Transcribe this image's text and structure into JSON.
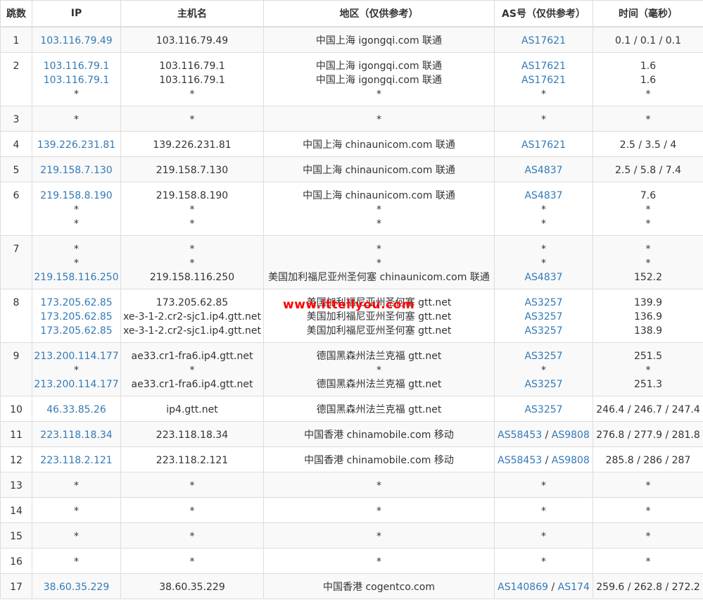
{
  "headers": [
    "跳数",
    "IP",
    "主机名",
    "地区（仅供参考）",
    "AS号（仅供参考）",
    "时间（毫秒）"
  ],
  "watermark": "www.ittellyou.com",
  "rows": [
    {
      "hop": "1",
      "lines": [
        {
          "ip": "103.116.79.49",
          "host": "103.116.79.49",
          "loc": "中国上海 igongqi.com 联通",
          "as": [
            "AS17621"
          ],
          "time": "0.1 / 0.1 / 0.1"
        }
      ]
    },
    {
      "hop": "2",
      "lines": [
        {
          "ip": "103.116.79.1",
          "host": "103.116.79.1",
          "loc": "中国上海 igongqi.com 联通",
          "as": [
            "AS17621"
          ],
          "time": "1.6"
        },
        {
          "ip": "103.116.79.1",
          "host": "103.116.79.1",
          "loc": "中国上海 igongqi.com 联通",
          "as": [
            "AS17621"
          ],
          "time": "1.6"
        },
        {
          "ip": "*",
          "host": "*",
          "loc": "*",
          "as": [
            "*"
          ],
          "time": "*"
        }
      ]
    },
    {
      "hop": "3",
      "lines": [
        {
          "ip": "*",
          "host": "*",
          "loc": "*",
          "as": [
            "*"
          ],
          "time": "*"
        }
      ]
    },
    {
      "hop": "4",
      "lines": [
        {
          "ip": "139.226.231.81",
          "host": "139.226.231.81",
          "loc": "中国上海 chinaunicom.com 联通",
          "as": [
            "AS17621"
          ],
          "time": "2.5 / 3.5 / 4"
        }
      ]
    },
    {
      "hop": "5",
      "lines": [
        {
          "ip": "219.158.7.130",
          "host": "219.158.7.130",
          "loc": "中国上海 chinaunicom.com 联通",
          "as": [
            "AS4837"
          ],
          "time": "2.5 / 5.8 / 7.4"
        }
      ]
    },
    {
      "hop": "6",
      "lines": [
        {
          "ip": "219.158.8.190",
          "host": "219.158.8.190",
          "loc": "中国上海 chinaunicom.com 联通",
          "as": [
            "AS4837"
          ],
          "time": "7.6"
        },
        {
          "ip": "*",
          "host": "*",
          "loc": "*",
          "as": [
            "*"
          ],
          "time": "*"
        },
        {
          "ip": "*",
          "host": "*",
          "loc": "*",
          "as": [
            "*"
          ],
          "time": "*"
        }
      ]
    },
    {
      "hop": "7",
      "lines": [
        {
          "ip": "*",
          "host": "*",
          "loc": "*",
          "as": [
            "*"
          ],
          "time": "*"
        },
        {
          "ip": "*",
          "host": "*",
          "loc": "*",
          "as": [
            "*"
          ],
          "time": "*"
        },
        {
          "ip": "219.158.116.250",
          "host": "219.158.116.250",
          "loc": "美国加利福尼亚州圣何塞 chinaunicom.com 联通",
          "as": [
            "AS4837"
          ],
          "time": "152.2"
        }
      ]
    },
    {
      "hop": "8",
      "lines": [
        {
          "ip": "173.205.62.85",
          "host": "173.205.62.85",
          "loc": "美国加利福尼亚州圣何塞 gtt.net",
          "as": [
            "AS3257"
          ],
          "time": "139.9"
        },
        {
          "ip": "173.205.62.85",
          "host": "xe-3-1-2.cr2-sjc1.ip4.gtt.net",
          "loc": "美国加利福尼亚州圣何塞 gtt.net",
          "as": [
            "AS3257"
          ],
          "time": "136.9"
        },
        {
          "ip": "173.205.62.85",
          "host": "xe-3-1-2.cr2-sjc1.ip4.gtt.net",
          "loc": "美国加利福尼亚州圣何塞 gtt.net",
          "as": [
            "AS3257"
          ],
          "time": "138.9"
        }
      ]
    },
    {
      "hop": "9",
      "lines": [
        {
          "ip": "213.200.114.177",
          "host": "ae33.cr1-fra6.ip4.gtt.net",
          "loc": "德国黑森州法兰克福 gtt.net",
          "as": [
            "AS3257"
          ],
          "time": "251.5"
        },
        {
          "ip": "*",
          "host": "*",
          "loc": "*",
          "as": [
            "*"
          ],
          "time": "*"
        },
        {
          "ip": "213.200.114.177",
          "host": "ae33.cr1-fra6.ip4.gtt.net",
          "loc": "德国黑森州法兰克福 gtt.net",
          "as": [
            "AS3257"
          ],
          "time": "251.3"
        }
      ]
    },
    {
      "hop": "10",
      "lines": [
        {
          "ip": "46.33.85.26",
          "host": "ip4.gtt.net",
          "loc": "德国黑森州法兰克福 gtt.net",
          "as": [
            "AS3257"
          ],
          "time": "246.4 / 246.7 / 247.4"
        }
      ]
    },
    {
      "hop": "11",
      "lines": [
        {
          "ip": "223.118.18.34",
          "host": "223.118.18.34",
          "loc": "中国香港 chinamobile.com 移动",
          "as": [
            "AS58453",
            "AS9808"
          ],
          "time": "276.8 / 277.9 / 281.8"
        }
      ]
    },
    {
      "hop": "12",
      "lines": [
        {
          "ip": "223.118.2.121",
          "host": "223.118.2.121",
          "loc": "中国香港 chinamobile.com 移动",
          "as": [
            "AS58453",
            "AS9808"
          ],
          "time": "285.8 / 286 / 287"
        }
      ]
    },
    {
      "hop": "13",
      "lines": [
        {
          "ip": "*",
          "host": "*",
          "loc": "*",
          "as": [
            "*"
          ],
          "time": "*"
        }
      ]
    },
    {
      "hop": "14",
      "lines": [
        {
          "ip": "*",
          "host": "*",
          "loc": "*",
          "as": [
            "*"
          ],
          "time": "*"
        }
      ]
    },
    {
      "hop": "15",
      "lines": [
        {
          "ip": "*",
          "host": "*",
          "loc": "*",
          "as": [
            "*"
          ],
          "time": "*"
        }
      ]
    },
    {
      "hop": "16",
      "lines": [
        {
          "ip": "*",
          "host": "*",
          "loc": "*",
          "as": [
            "*"
          ],
          "time": "*"
        }
      ]
    },
    {
      "hop": "17",
      "lines": [
        {
          "ip": "38.60.35.229",
          "host": "38.60.35.229",
          "loc": "中国香港 cogentco.com",
          "as": [
            "AS140869",
            "AS174"
          ],
          "time": "259.6 / 262.8 / 272.2"
        }
      ]
    }
  ]
}
